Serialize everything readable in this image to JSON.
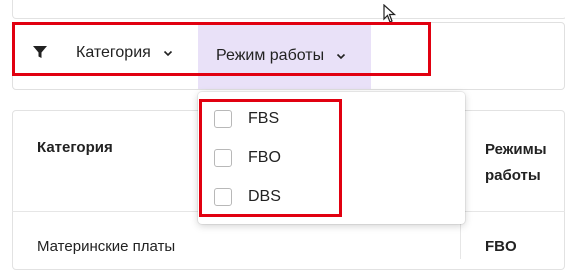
{
  "filters": {
    "category_label": "Категория",
    "mode_label": "Режим работы",
    "icons": {
      "filter": "filter-icon",
      "chevron": "chevron-down-icon"
    }
  },
  "dropdown": {
    "options": [
      {
        "label": "FBS",
        "checked": false
      },
      {
        "label": "FBO",
        "checked": false
      },
      {
        "label": "DBS",
        "checked": false
      }
    ]
  },
  "table": {
    "headers": {
      "category": "Категория",
      "modes": "Режимы работы"
    },
    "rows": [
      {
        "category": "Материнские платы",
        "mode": "FBO"
      }
    ]
  },
  "colors": {
    "highlight": "#e9e1f8",
    "annotation": "#e10010"
  }
}
